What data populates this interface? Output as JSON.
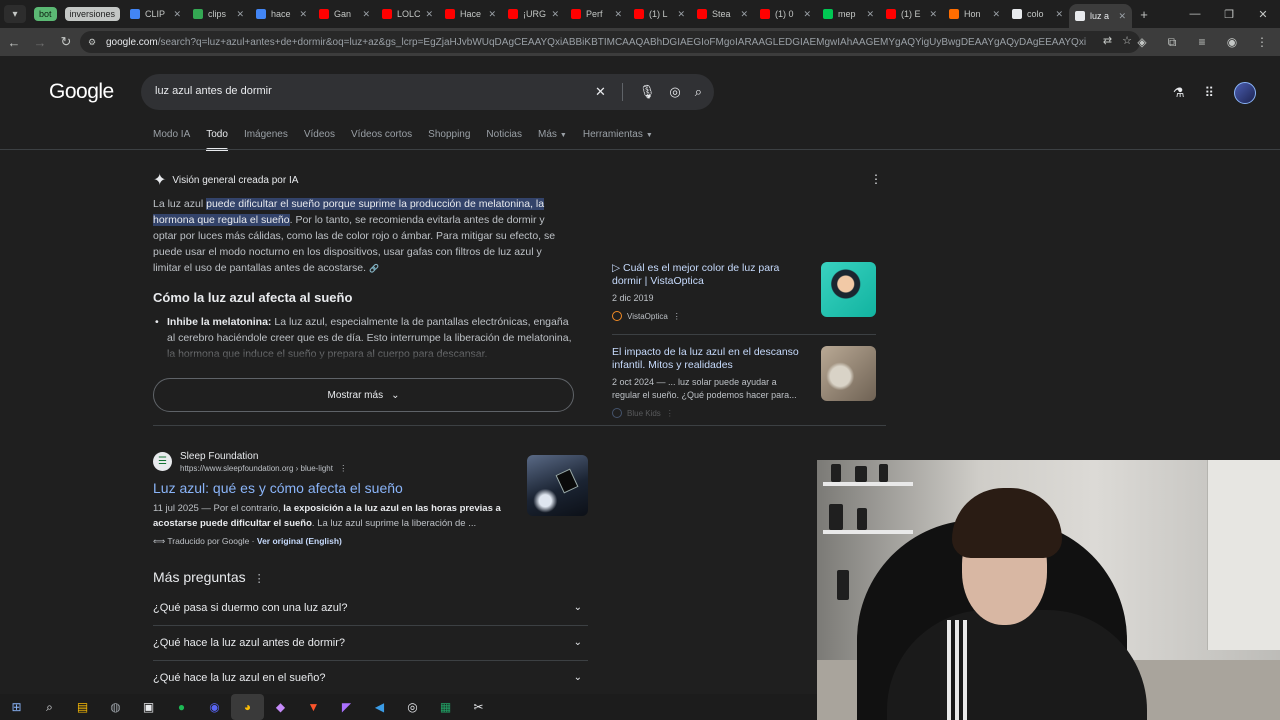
{
  "browser": {
    "tab_groups": [
      "bot",
      "inversiones"
    ],
    "tabs": [
      {
        "label": "CLIP",
        "color": "#4285f4"
      },
      {
        "label": "clips",
        "color": "#34a853"
      },
      {
        "label": "hace",
        "color": "#4285f4"
      },
      {
        "label": "Gan",
        "color": "#ff0000"
      },
      {
        "label": "LOLC",
        "color": "#ff0000"
      },
      {
        "label": "Hace",
        "color": "#ff0000"
      },
      {
        "label": "¡URG",
        "color": "#ff0000"
      },
      {
        "label": "Perf",
        "color": "#ff0000"
      },
      {
        "label": "(1) L",
        "color": "#ff0000"
      },
      {
        "label": "Stea",
        "color": "#ff0000"
      },
      {
        "label": "(1) 0",
        "color": "#ff0000"
      },
      {
        "label": "mep",
        "color": "#00c853"
      },
      {
        "label": "(1) E",
        "color": "#ff0000"
      },
      {
        "label": "Hon",
        "color": "#ff6d00"
      },
      {
        "label": "colo",
        "color": "#e8eaed"
      },
      {
        "label": "luz a",
        "color": "#e8eaed"
      }
    ],
    "active_tab_index": 15,
    "url_main": "google.com",
    "url_rest": "/search?q=luz+azul+antes+de+dormir&oq=luz+az&gs_lcrp=EgZjaHJvbWUqDAgCEAAYQxiABBiKBTIMCAAQABhDGIAEGIoFMgoIARAAGLEDGIAEMgwIAhAAGEMYgAQYigUyBwgDEAAYgAQyDAgEEAAYQxiABBiKBTIHCAUQABiABA"
  },
  "google": {
    "logo": "Google",
    "query": "luz azul antes de dormir",
    "nav_tabs": [
      "Modo IA",
      "Todo",
      "Imágenes",
      "Vídeos",
      "Vídeos cortos",
      "Shopping",
      "Noticias",
      "Más",
      "Herramientas"
    ],
    "active_nav": "Todo"
  },
  "ai_overview": {
    "header": "Visión general creada por IA",
    "p_lead": "La luz azul ",
    "p_highlight": "puede dificultar el sueño porque suprime la producción de melatonina, la hormona que regula el sueño",
    "p_rest": ". Por lo tanto, se recomienda evitarla antes de dormir y optar por luces más cálidas, como las de color rojo o ámbar. Para mitigar su efecto, se puede usar el modo nocturno en los dispositivos, usar gafas con filtros de luz azul y limitar el uso de pantallas antes de acostarse.",
    "subheading": "Cómo la luz azul afecta al sueño",
    "bullet_bold": "Inhibe la melatonina:",
    "bullet_text": " La luz azul, especialmente la de pantallas electrónicas, engaña al cerebro haciéndole creer que es de día. Esto interrumpe la liberación de melatonina, la hormona que induce el sueño y prepara al cuerpo para descansar.",
    "show_more": "Mostrar más",
    "sources": [
      {
        "title": "▷ Cuál es el mejor color de luz para dormir | VistaOptica",
        "date": "2 dic 2019",
        "site": "VistaOptica"
      },
      {
        "title": "El impacto de la luz azul en el descanso infantil. Mitos y realidades",
        "date": "2 oct 2024 — ... luz solar puede ayudar a regular el sueño. ¿Qué podemos hacer para...",
        "site": "Blue Kids"
      }
    ]
  },
  "result": {
    "site_name": "Sleep Foundation",
    "site_url": "https://www.sleepfoundation.org › blue-light",
    "title": "Luz azul: qué es y cómo afecta el sueño",
    "snippet_pre": "11 jul 2025 — Por el contrario, ",
    "snippet_bold": "la exposición a la luz azul en las horas previas a acostarse puede dificultar el sueño",
    "snippet_post": ". La luz azul suprime la liberación de ...",
    "translated": "Traducido por Google · ",
    "original_link": "Ver original (English)"
  },
  "more_questions": {
    "heading": "Más preguntas",
    "items": [
      "¿Qué pasa si duermo con una luz azul?",
      "¿Qué hace la luz azul antes de dormir?",
      "¿Qué hace la luz azul en el sueño?"
    ]
  }
}
